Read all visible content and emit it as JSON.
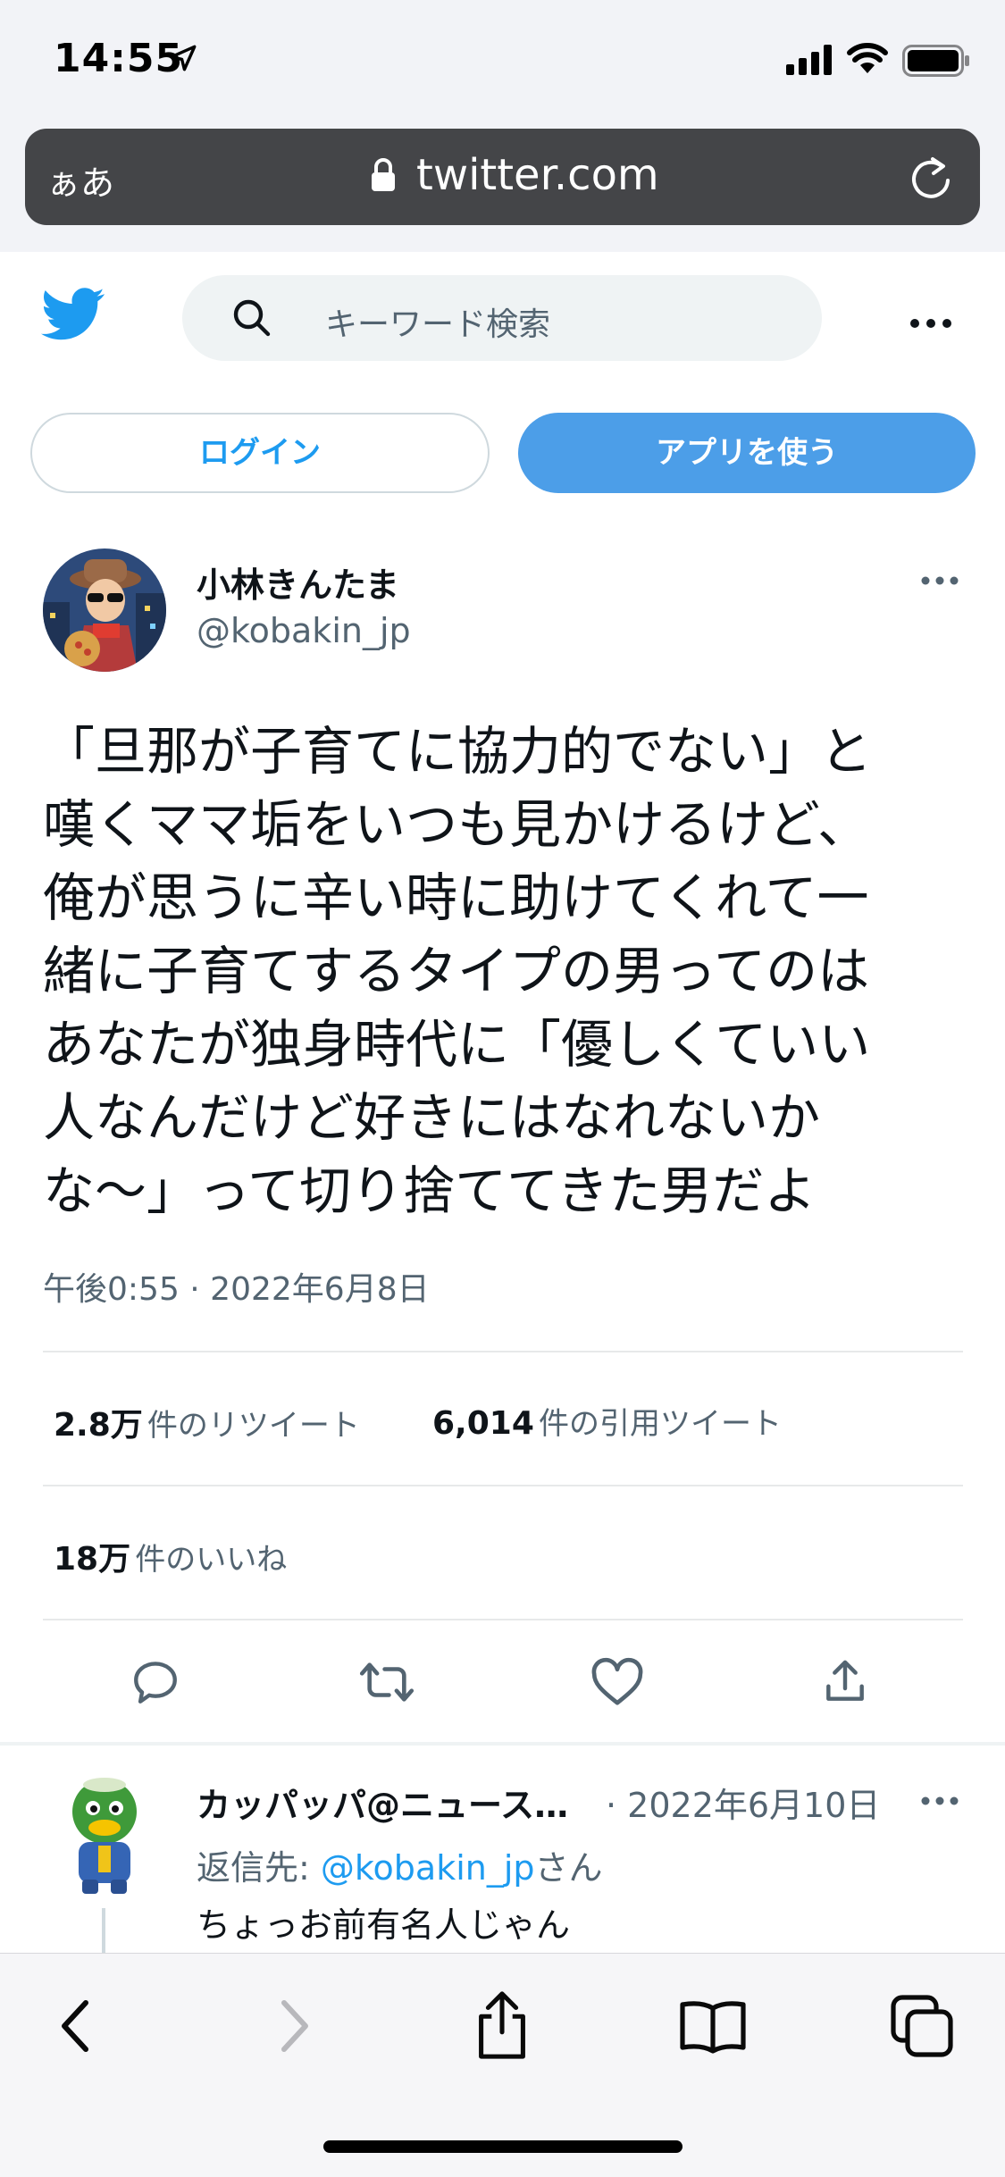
{
  "status_bar": {
    "time": "14:55"
  },
  "address_bar": {
    "text_size_label": "ぁあ",
    "url": "twitter.com"
  },
  "twitter_header": {
    "search_placeholder": "キーワード検索"
  },
  "auth_buttons": {
    "login_label": "ログイン",
    "use_app_label": "アプリを使う"
  },
  "tweet": {
    "author_name": "小林きんたま",
    "author_handle": "@kobakin_jp",
    "lines": [
      "「旦那が子育てに協力的でない」と",
      "嘆くママ垢をいつも見かけるけど、",
      "俺が思うに辛い時に助けてくれて一",
      "緒に子育てするタイプの男ってのは",
      "あなたが独身時代に「優しくていい",
      "人なんだけど好きにはなれないか",
      "な〜」って切り捨ててきた男だよ"
    ],
    "timestamp": "午後0:55 · 2022年6月8日",
    "retweets": {
      "count": "2.8万",
      "label": "件のリツイート"
    },
    "quotes": {
      "count": "6,014",
      "label": "件の引用ツイート"
    },
    "likes": {
      "count": "18万",
      "label": "件のいいね"
    }
  },
  "reply": {
    "author_name": "カッパッパ@ニュース…",
    "date": "· 2022年6月10日",
    "reply_to_prefix": "返信先: ",
    "reply_to_handle": "@kobakin_jp",
    "reply_to_suffix": "さん",
    "text": "ちょっお前有名人じゃん"
  },
  "icons": {
    "location": "location-arrow-icon",
    "signal": "cellular-signal-icon",
    "wifi": "wifi-icon",
    "battery": "battery-icon",
    "lock": "lock-icon",
    "reload": "reload-icon",
    "brand": "twitter-bird-icon",
    "search": "search-icon",
    "more": "more-dots-icon",
    "reply": "reply-icon",
    "retweet": "retweet-icon",
    "like": "heart-icon",
    "share": "share-icon",
    "back": "chevron-left-icon",
    "forward": "chevron-right-icon",
    "bookmarks": "book-icon",
    "tabs": "tabs-icon"
  },
  "colors": {
    "twitter_blue": "#1d9bf0",
    "app_button": "#4c9ee8",
    "secondary_text": "#536471",
    "address_bar": "#444548"
  }
}
